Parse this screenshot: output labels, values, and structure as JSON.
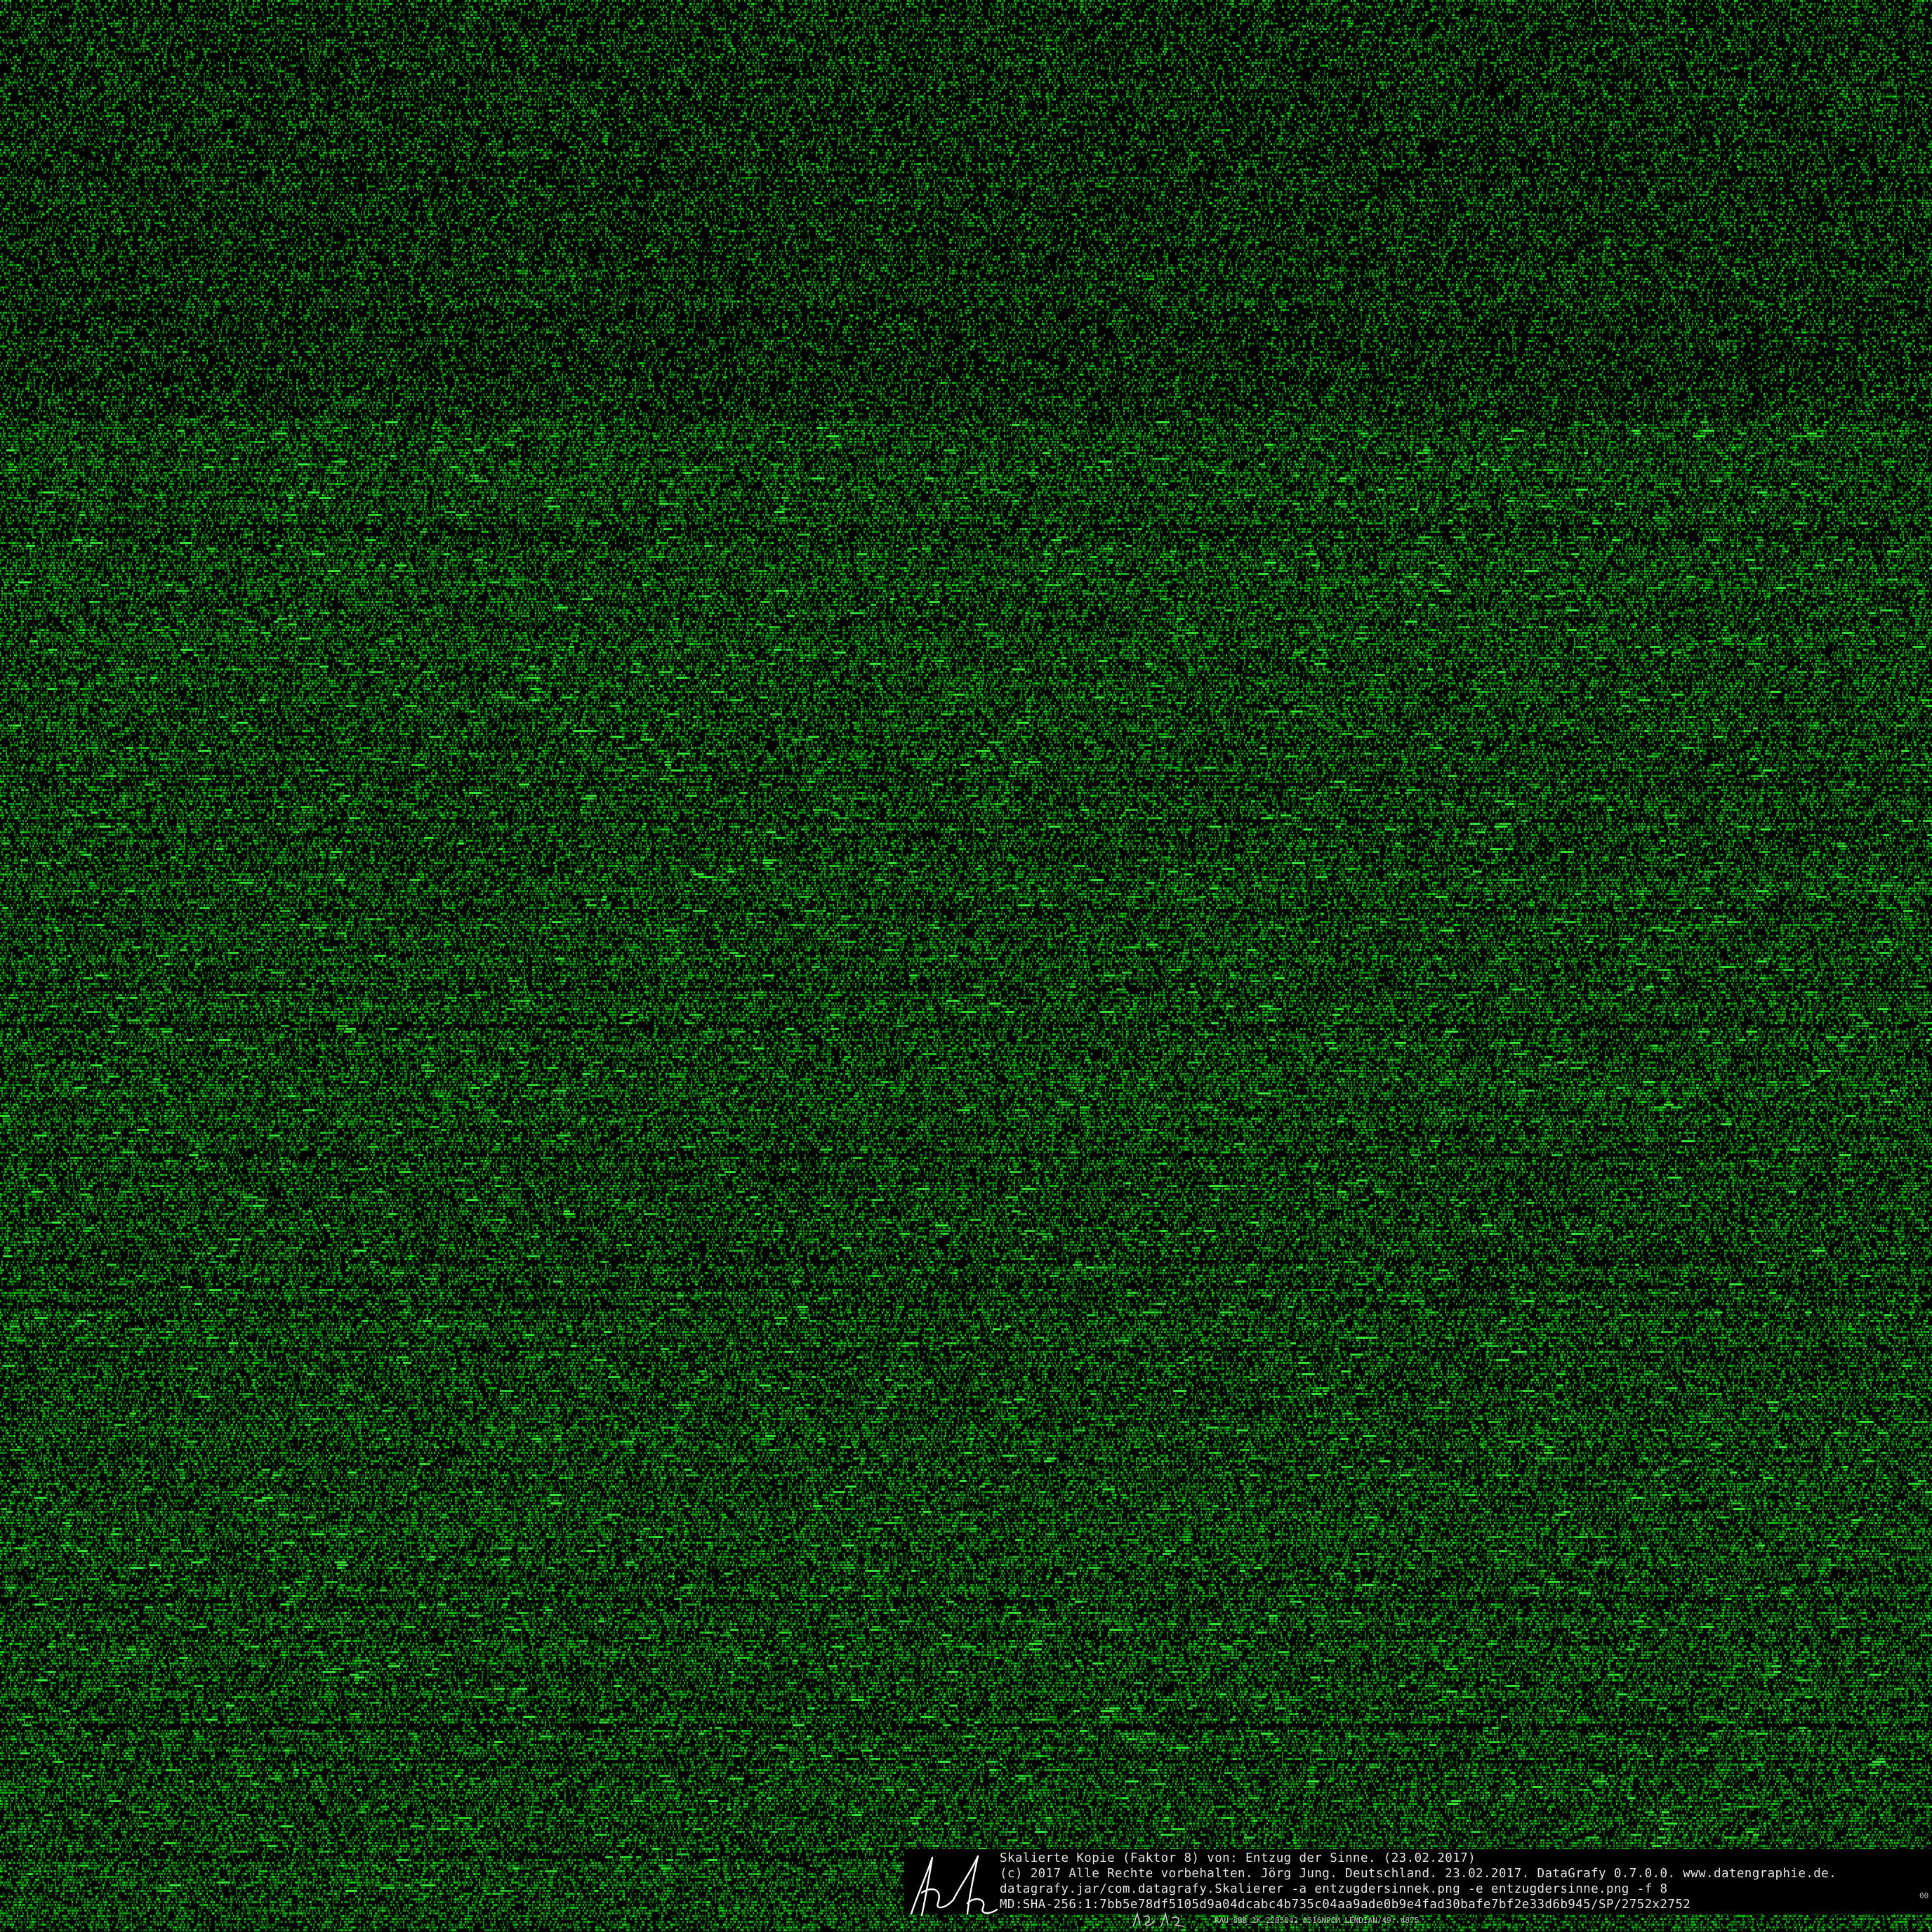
{
  "image": {
    "background_color": "#000000",
    "noise_color": "#22cc22",
    "bright_color": "#3cff3c"
  },
  "caption": {
    "line1": "Skalierte Kopie (Faktor 8) von: Entzug der Sinne. (23.02.2017)",
    "line2": "(c) 2017 Alle Rechte vorbehalten. Jörg Jung. Deutschland. 23.02.2017. DataGrafy 0.7.0.0. www.datengraphie.de.",
    "line3": "datagrafy.jar/com.datagrafy.Skalierer -a entzugdersinnek.png -e entzugdersinne.png -f 8",
    "line4": "MD:SHA-256:1:7bb5e78df5105d9a04dcabc4b735c04aa9ade0b9e4fad30bafe7bf2e33d6b945/SP/2752x2752",
    "footer": "RAU_8BB_2K_2205042_0516NPCM_LENDIAN/49: 4875",
    "side_code": "00",
    "signature_color": "#ffffff",
    "text_color": "#e6e6e6"
  }
}
